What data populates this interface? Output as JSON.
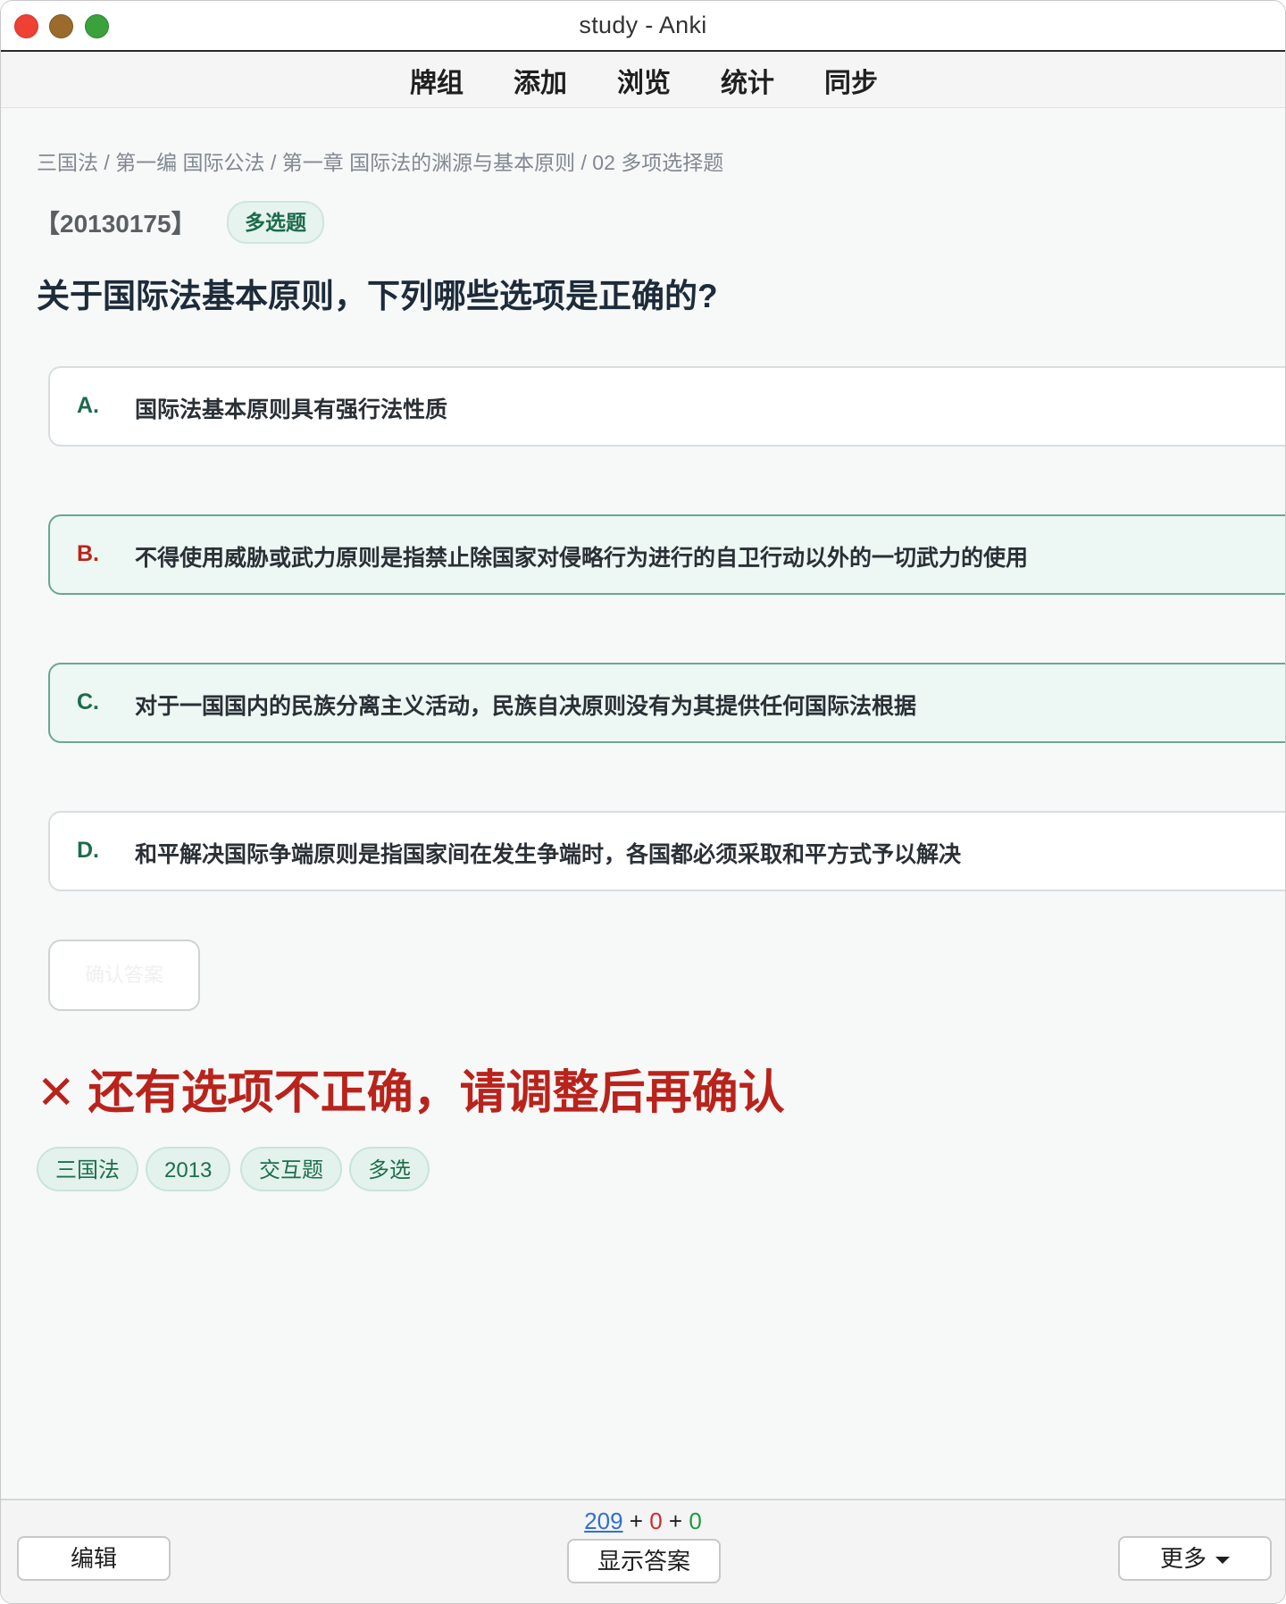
{
  "window": {
    "title": "study - Anki"
  },
  "toolbar": {
    "items": [
      "牌组",
      "添加",
      "浏览",
      "统计",
      "同步"
    ]
  },
  "card": {
    "breadcrumb": "三国法 / 第一编 国际公法 / 第一章 国际法的渊源与基本原则 / 02 多项选择题",
    "id": "【20130175】",
    "type_badge": "多选题",
    "question": "关于国际法基本原则，下列哪些选项是正确的?",
    "options": [
      {
        "letter": "A.",
        "text": "国际法基本原则具有强行法性质",
        "selected": false,
        "letter_color": "#1d6b4c"
      },
      {
        "letter": "B.",
        "text": "不得使用威胁或武力原则是指禁止除国家对侵略行为进行的自卫行动以外的一切武力的使用",
        "selected": true,
        "letter_color": "#b9231b"
      },
      {
        "letter": "C.",
        "text": "对于一国国内的民族分离主义活动，民族自决原则没有为其提供任何国际法根据",
        "selected": true,
        "letter_color": "#1d6b4c"
      },
      {
        "letter": "D.",
        "text": "和平解决国际争端原则是指国家间在发生争端时，各国都必须采取和平方式予以解决",
        "selected": false,
        "letter_color": "#1d6b4c"
      }
    ],
    "confirm_label": "确认答案",
    "feedback_icon": "✕",
    "feedback_text": "还有选项不正确，请调整后再确认",
    "tags": [
      "三国法",
      "2013",
      "交互题",
      "多选"
    ]
  },
  "bottom": {
    "count_new": "209",
    "count_learn": "0",
    "count_review": "0",
    "edit_label": "编辑",
    "show_answer_label": "显示答案",
    "more_label": "更多"
  },
  "colors": {
    "accent_green": "#1d6b4c",
    "error_red": "#b9231b",
    "new_blue": "#2f6fd6",
    "learn_red": "#d12a2a",
    "review_green": "#1f9a3d"
  }
}
